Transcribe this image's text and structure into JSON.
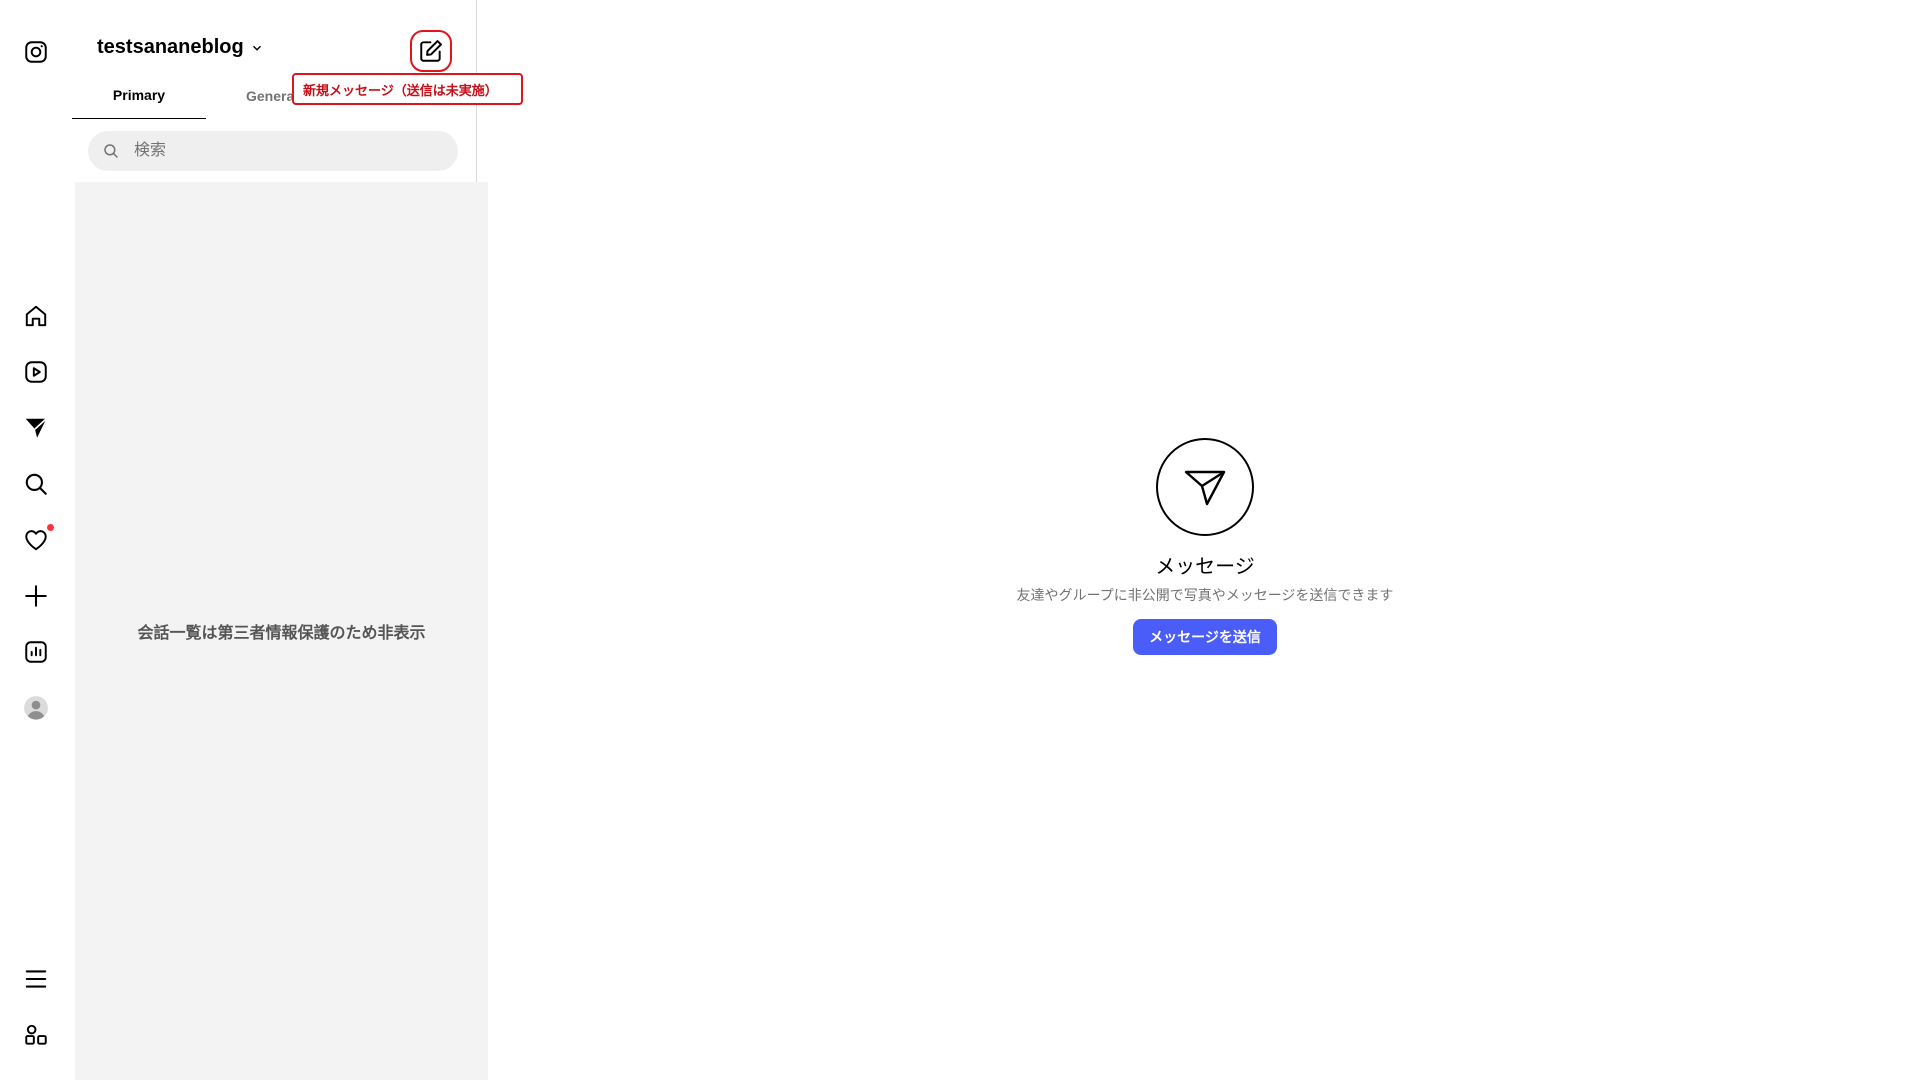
{
  "rail": {
    "items": [
      {
        "icon": "instagram-logo-icon"
      },
      {
        "icon": "home-icon"
      },
      {
        "icon": "reels-icon"
      },
      {
        "icon": "messages-icon"
      },
      {
        "icon": "search-icon"
      },
      {
        "icon": "notifications-heart-icon"
      },
      {
        "icon": "create-plus-icon"
      },
      {
        "icon": "insights-icon"
      },
      {
        "icon": "profile-avatar-icon"
      },
      {
        "icon": "menu-icon"
      },
      {
        "icon": "more-apps-icon"
      }
    ],
    "notification_dot_color": "#ff3040"
  },
  "list": {
    "account_name": "testsananeblog",
    "compose_callout": "新規メッセージ（送信は未実施）",
    "tabs": [
      {
        "label": "Primary",
        "active": true
      },
      {
        "label": "General",
        "active": false
      }
    ],
    "search": {
      "placeholder": "検索",
      "value": ""
    },
    "hidden_notice": "会話一覧は第三者情報保護のため非表示"
  },
  "main": {
    "empty_title": "メッセージ",
    "empty_subtitle": "友達やグループに非公開で写真やメッセージを送信できます",
    "send_button": "メッセージを送信"
  },
  "colors": {
    "accent": "#4a5df9",
    "annotation_red": "#e0141b",
    "hidden_panel_bg": "#f3f3f4"
  }
}
